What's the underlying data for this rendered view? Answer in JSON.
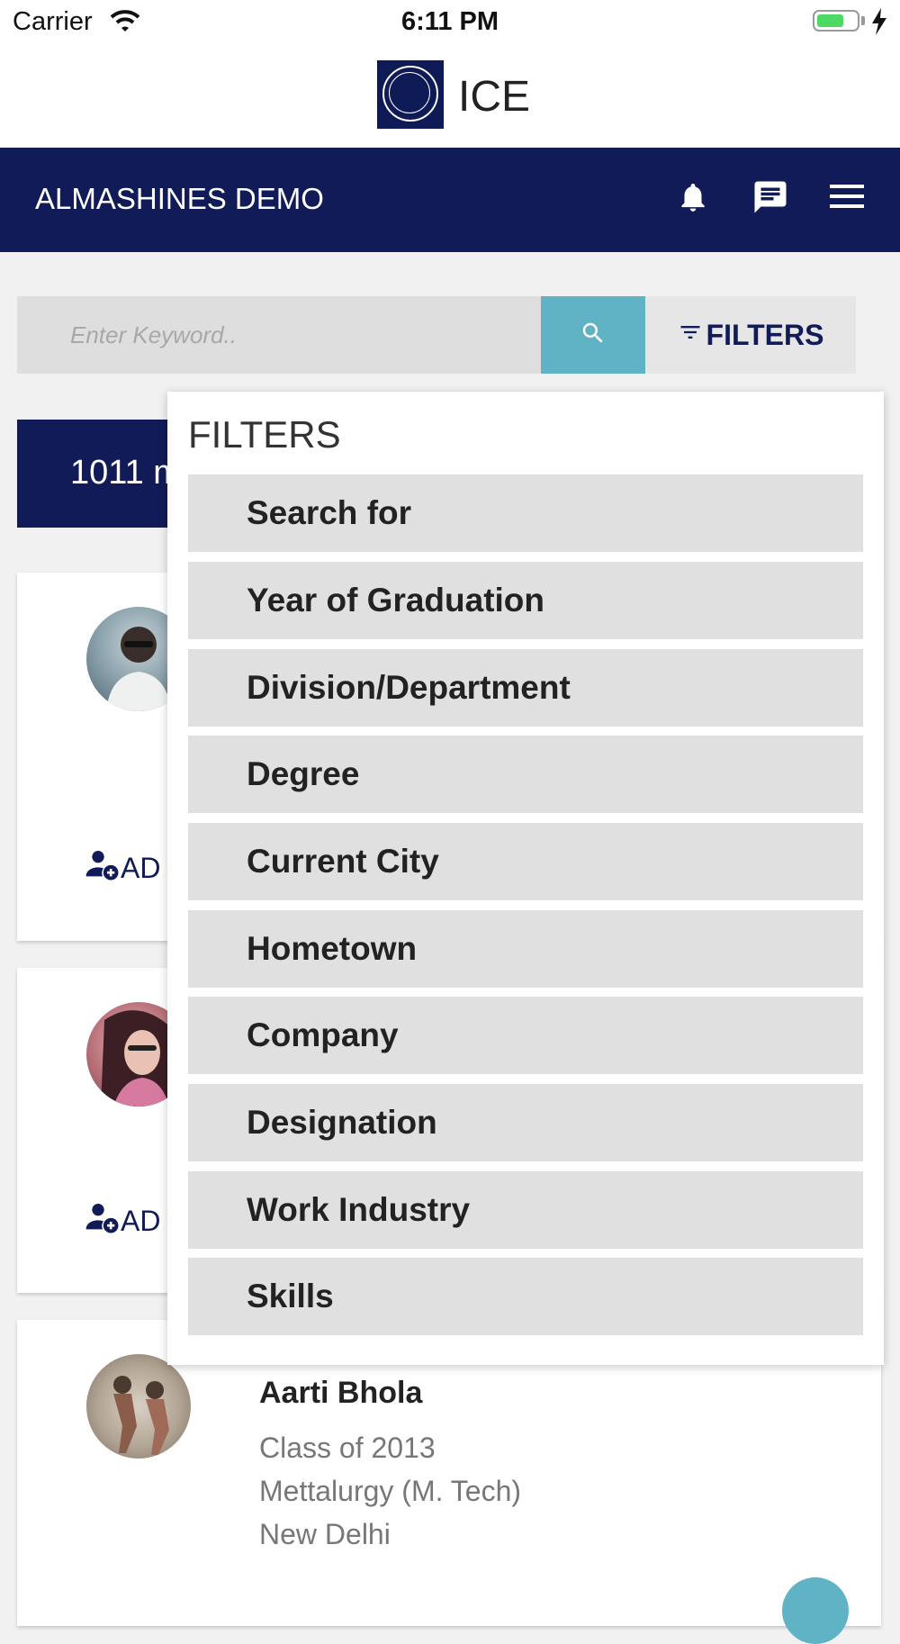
{
  "status_bar": {
    "carrier": "Carrier",
    "time": "6:11 PM",
    "battery_level": 0.7,
    "wifi_icon": "wifi-icon",
    "charging_icon": "bolt-icon"
  },
  "header": {
    "app_title": "ICE",
    "logo": "college-seal-logo"
  },
  "navbar": {
    "title": "ALMASHINES DEMO",
    "icons": [
      "bell-icon",
      "chat-icon",
      "menu-icon"
    ]
  },
  "search": {
    "placeholder": "Enter Keyword..",
    "value": "",
    "search_icon": "search-icon",
    "filters_label": "FILTERS"
  },
  "results": {
    "count_text": "1011 m"
  },
  "cards": [
    {
      "add_label": "AD"
    },
    {
      "add_label": "AD"
    },
    {
      "name": "Aarti Bhola",
      "class_of": "Class of 2013",
      "department": "Mettalurgy (M. Tech)",
      "city": "New Delhi"
    }
  ],
  "filters_panel": {
    "title": "FILTERS",
    "items": [
      "Search for",
      "Year of Graduation",
      "Division/Department",
      "Degree",
      "Current City",
      "Hometown",
      "Company",
      "Designation",
      "Work Industry",
      "Skills"
    ]
  },
  "colors": {
    "brand_navy": "#111b57",
    "accent_teal": "#5fb3c4",
    "panel_item_bg": "#e0e0e0",
    "page_bg": "#f1f1f1"
  }
}
